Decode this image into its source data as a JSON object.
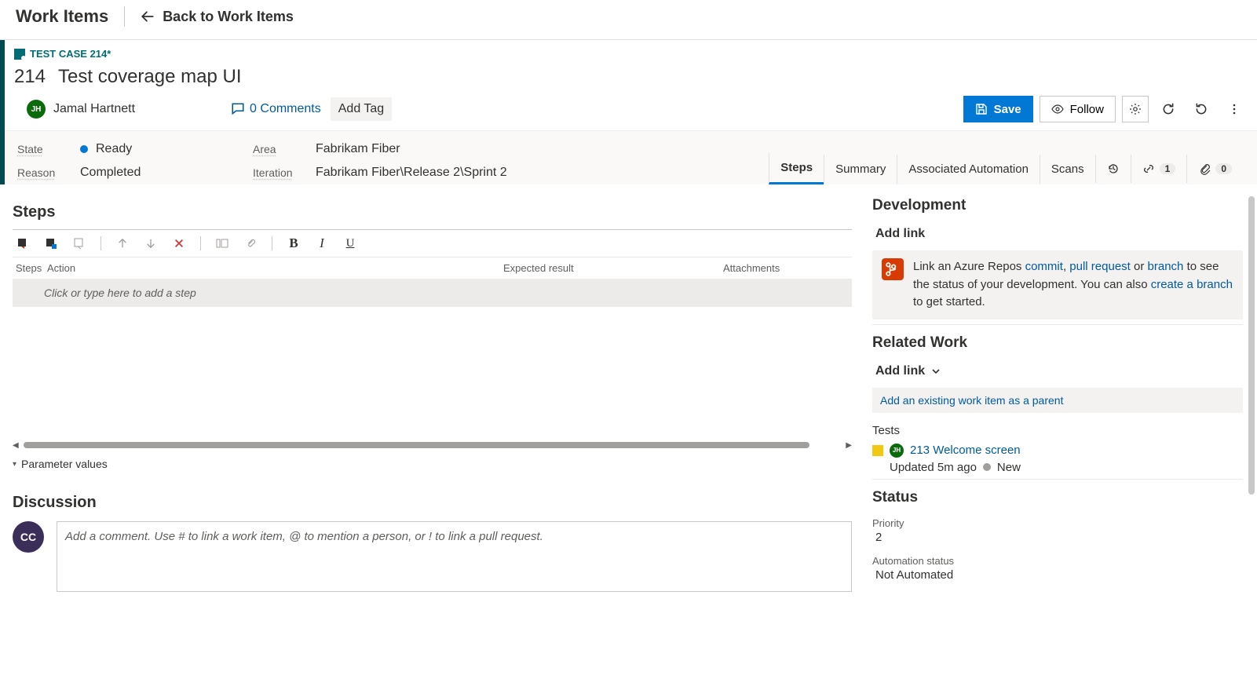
{
  "topbar": {
    "brand": "Work Items",
    "back": "Back to Work Items"
  },
  "workitem": {
    "type_label": "TEST CASE 214*",
    "id": "214",
    "title": "Test coverage map UI"
  },
  "assignee": {
    "name": "Jamal Hartnett",
    "initials": "JH"
  },
  "comments": {
    "label": "0 Comments"
  },
  "addtag": "Add Tag",
  "buttons": {
    "save": "Save",
    "follow": "Follow"
  },
  "fields": {
    "state_label": "State",
    "state_value": "Ready",
    "reason_label": "Reason",
    "reason_value": "Completed",
    "area_label": "Area",
    "area_value": "Fabrikam Fiber",
    "iter_label": "Iteration",
    "iter_value": "Fabrikam Fiber\\Release 2\\Sprint 2"
  },
  "tabs": {
    "steps": "Steps",
    "summary": "Summary",
    "assoc": "Associated Automation",
    "scans": "Scans",
    "link_badge": "1",
    "attach_badge": "0"
  },
  "steps": {
    "title": "Steps",
    "col_steps": "Steps",
    "col_action": "Action",
    "col_expected": "Expected result",
    "col_attach": "Attachments",
    "placeholder": "Click or type here to add a step",
    "param_label": "Parameter values"
  },
  "discussion": {
    "title": "Discussion",
    "initials": "CC",
    "placeholder": "Add a comment. Use # to link a work item, @ to mention a person, or ! to link a pull request."
  },
  "side": {
    "development": {
      "title": "Development",
      "add_link": "Add link",
      "text_pre": "Link an Azure Repos ",
      "commit": "commit",
      "sep1": ", ",
      "pull_request": "pull request",
      "text_mid": " or ",
      "branch": "branch",
      "text_mid2": " to see the status of your development. You can also ",
      "create_branch": "create a branch",
      "text_post": " to get started."
    },
    "related": {
      "title": "Related Work",
      "add_link": "Add link",
      "parent_link": "Add an existing work item as a parent",
      "tests_label": "Tests",
      "test_item": {
        "id": "213",
        "name": "Welcome screen",
        "initials": "JH"
      },
      "test_meta_updated": "Updated 5m ago",
      "test_meta_state": "New"
    },
    "status": {
      "title": "Status",
      "priority_label": "Priority",
      "priority_value": "2",
      "auto_label": "Automation status",
      "auto_value": "Not Automated"
    }
  }
}
